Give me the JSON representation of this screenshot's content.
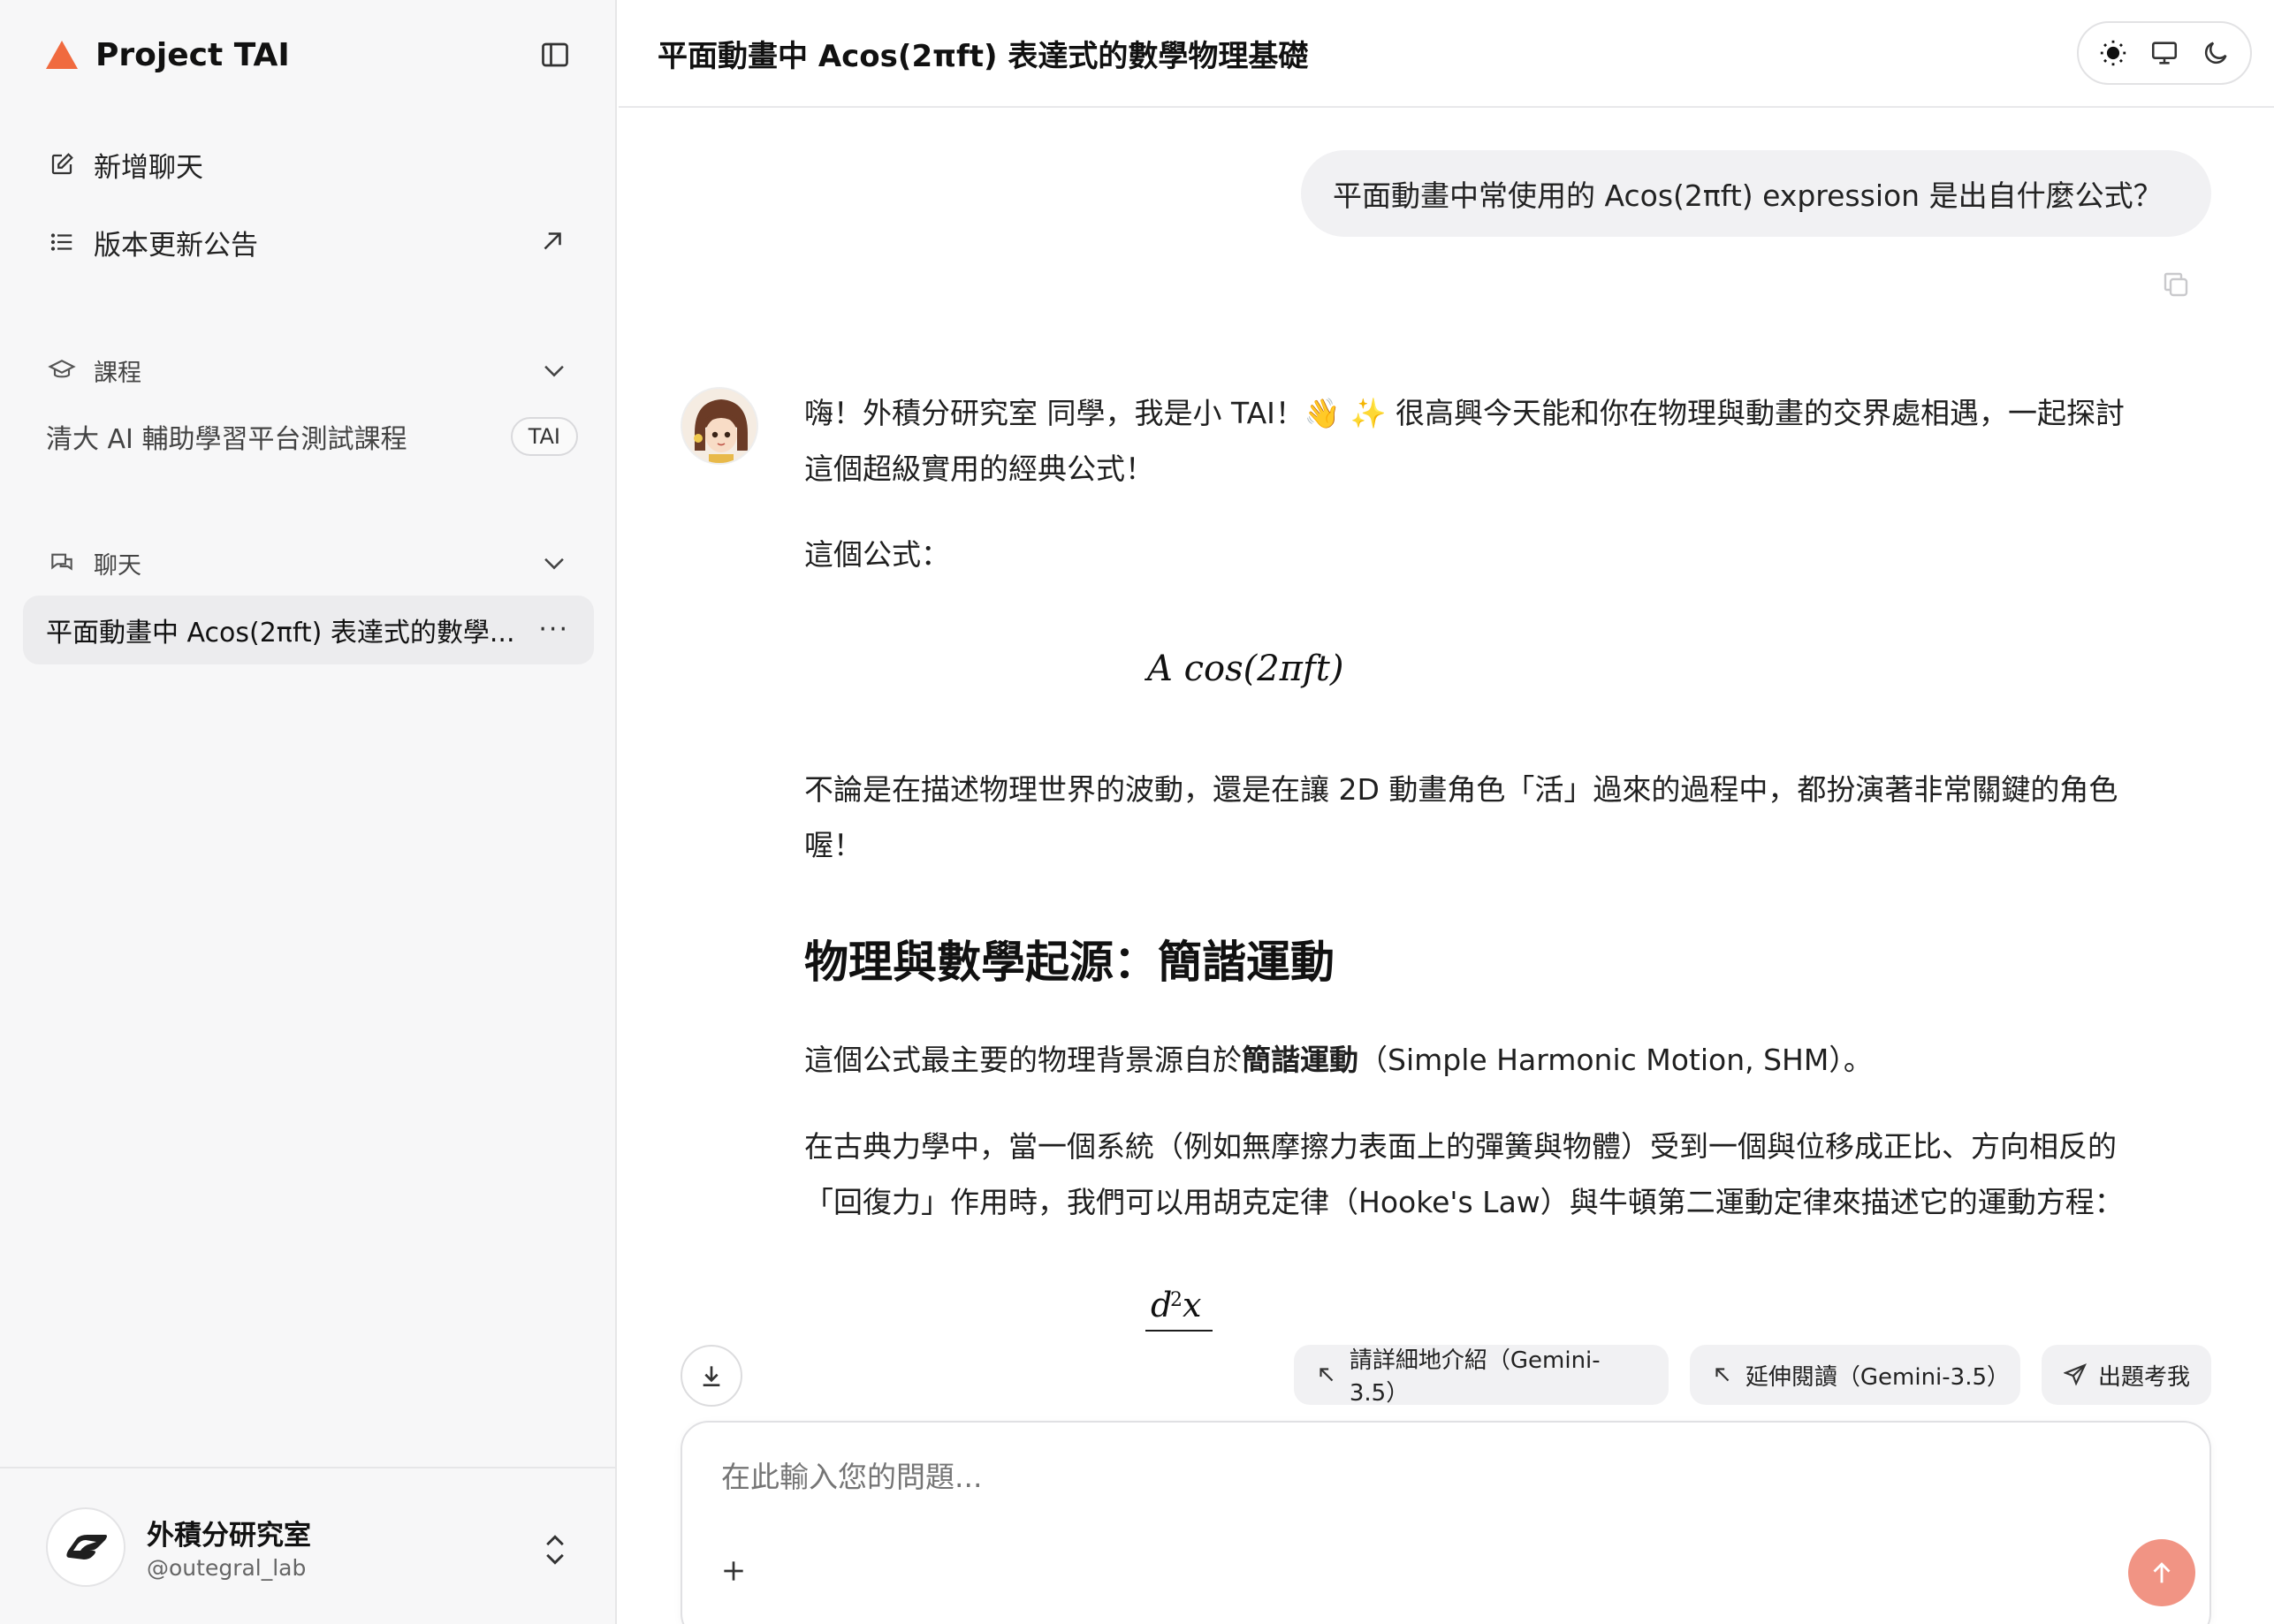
{
  "sidebar": {
    "brand": "Project TAI",
    "nav": {
      "new_chat": "新增聊天",
      "changelog": "版本更新公告"
    },
    "courses": {
      "title": "課程",
      "item": "清大 AI 輔助學習平台測試課程",
      "tag": "TAI"
    },
    "chats": {
      "title": "聊天",
      "item": "平面動畫中 Acos(2πft) 表達式的數學..."
    },
    "user": {
      "name": "外積分研究室",
      "handle": "@outegral_lab"
    }
  },
  "header": {
    "title": "平面動畫中 Acos(2πft) 表達式的數學物理基礎"
  },
  "conversation": {
    "user_message": "平面動畫中常使用的 Acos(2πft) expression 是出自什麼公式？",
    "answer": {
      "para1_line1": "嗨！外積分研究室 同學，我是小 TAI！👋 ✨ 很高興今天能和你在物理與動畫的交界處相遇，一起探討",
      "para1_line2": "這個超級實用的經典公式！",
      "para2": "這個公式：",
      "formula1": "A cos(2πft)",
      "para3_line1": "不論是在描述物理世界的波動，還是在讓 2D 動畫角色「活」過來的過程中，都扮演著非常關鍵的角色",
      "para3_line2": "喔！",
      "heading": "物理與數學起源：簡諧運動",
      "para4_prefix": "這個公式最主要的物理背景源自於",
      "para4_bold": "簡諧運動",
      "para4_suffix": "（Simple Harmonic Motion, SHM）。",
      "para5_line1": "在古典力學中，當一個系統（例如無摩擦力表面上的彈簧與物體）受到一個與位移成正比、方向相反的",
      "para5_line2": "「回復力」作用時，我們可以用胡克定律（Hooke's Law）與牛頓第二運動定律來描述它的運動方程："
    }
  },
  "suggestions": [
    "請詳細地介紹（Gemini-3.5）",
    "延伸閱讀（Gemini-3.5）",
    "出題考我"
  ],
  "composer": {
    "placeholder": "在此輸入您的問題..."
  },
  "colors": {
    "brand": "#f06a3f",
    "send": "#f19484",
    "sidebar_bg": "#f7f7f8"
  }
}
